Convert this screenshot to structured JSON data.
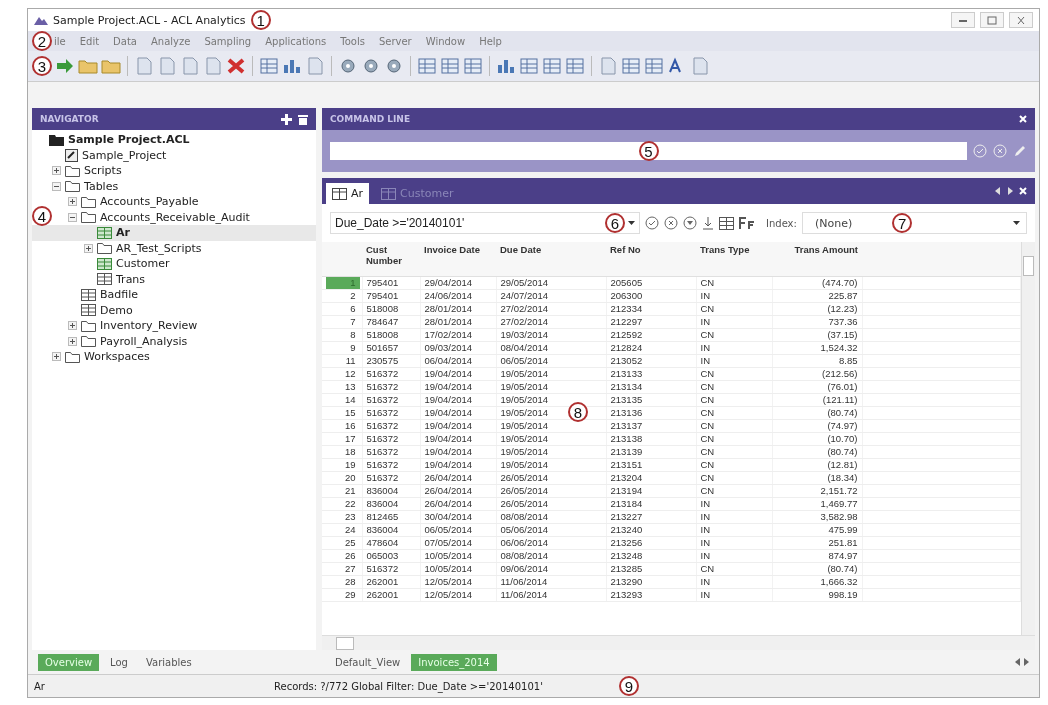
{
  "window": {
    "title": "Sample Project.ACL - ACL Analytics",
    "callout": "1"
  },
  "menu": {
    "callout": "2",
    "items": [
      "ile",
      "Edit",
      "Data",
      "Analyze",
      "Sampling",
      "Applications",
      "Tools",
      "Server",
      "Window",
      "Help"
    ]
  },
  "toolbar": {
    "callout": "3"
  },
  "navigator": {
    "title": "NAVIGATOR",
    "callout": "4",
    "tree": [
      {
        "label": "Sample Project.ACL",
        "kind": "project",
        "selected": false,
        "children": [
          {
            "label": "Sample_Project",
            "kind": "script",
            "selected": false
          },
          {
            "label": "Scripts",
            "kind": "folder",
            "expanded": false,
            "selected": false
          },
          {
            "label": "Tables",
            "kind": "folder",
            "expanded": true,
            "selected": false,
            "children": [
              {
                "label": "Accounts_Payable",
                "kind": "folder",
                "expanded": false,
                "selected": false
              },
              {
                "label": "Accounts_Receivable_Audit",
                "kind": "folder",
                "expanded": true,
                "selected": false,
                "children": [
                  {
                    "label": "Ar",
                    "kind": "table",
                    "open": true,
                    "selected": true
                  },
                  {
                    "label": "AR_Test_Scripts",
                    "kind": "folder",
                    "expanded": false,
                    "selected": false
                  },
                  {
                    "label": "Customer",
                    "kind": "table",
                    "open": true,
                    "selected": false
                  },
                  {
                    "label": "Trans",
                    "kind": "table",
                    "open": false,
                    "selected": false
                  }
                ]
              },
              {
                "label": "Badfile",
                "kind": "table",
                "open": false,
                "selected": false
              },
              {
                "label": "Demo",
                "kind": "table",
                "open": false,
                "selected": false
              },
              {
                "label": "Inventory_Review",
                "kind": "folder",
                "expanded": false,
                "selected": false
              },
              {
                "label": "Payroll_Analysis",
                "kind": "folder",
                "expanded": false,
                "selected": false
              }
            ]
          },
          {
            "label": "Workspaces",
            "kind": "folder",
            "expanded": false,
            "selected": false
          }
        ]
      }
    ]
  },
  "command_line": {
    "title": "COMMAND LINE",
    "callout": "5"
  },
  "view_tabs": [
    {
      "label": "Ar",
      "selected": true
    },
    {
      "label": "Customer",
      "selected": false
    }
  ],
  "filter": {
    "value": "Due_Date >='20140101'",
    "callout": "6",
    "index_label": "Index:",
    "index_value": "(None)",
    "index_callout": "7"
  },
  "table": {
    "callout": "8",
    "columns": [
      {
        "label": "Cust Number"
      },
      {
        "label": "Invoice Date"
      },
      {
        "label": "Due Date"
      },
      {
        "label": "Ref No"
      },
      {
        "label": "Trans Type"
      },
      {
        "label": "Trans Amount"
      }
    ],
    "rows": [
      {
        "n": "1",
        "selected": true,
        "cells": [
          "795401",
          "29/04/2014",
          "29/05/2014",
          "205605",
          "CN",
          "(474.70)"
        ]
      },
      {
        "n": "2",
        "selected": false,
        "cells": [
          "795401",
          "24/06/2014",
          "24/07/2014",
          "206300",
          "IN",
          "225.87"
        ]
      },
      {
        "n": "6",
        "selected": false,
        "cells": [
          "518008",
          "28/01/2014",
          "27/02/2014",
          "212334",
          "CN",
          "(12.23)"
        ]
      },
      {
        "n": "7",
        "selected": false,
        "cells": [
          "784647",
          "28/01/2014",
          "27/02/2014",
          "212297",
          "IN",
          "737.36"
        ]
      },
      {
        "n": "8",
        "selected": false,
        "cells": [
          "518008",
          "17/02/2014",
          "19/03/2014",
          "212592",
          "CN",
          "(37.15)"
        ]
      },
      {
        "n": "9",
        "selected": false,
        "cells": [
          "501657",
          "09/03/2014",
          "08/04/2014",
          "212824",
          "IN",
          "1,524.32"
        ]
      },
      {
        "n": "11",
        "selected": false,
        "cells": [
          "230575",
          "06/04/2014",
          "06/05/2014",
          "213052",
          "IN",
          "8.85"
        ]
      },
      {
        "n": "12",
        "selected": false,
        "cells": [
          "516372",
          "19/04/2014",
          "19/05/2014",
          "213133",
          "CN",
          "(212.56)"
        ]
      },
      {
        "n": "13",
        "selected": false,
        "cells": [
          "516372",
          "19/04/2014",
          "19/05/2014",
          "213134",
          "CN",
          "(76.01)"
        ]
      },
      {
        "n": "14",
        "selected": false,
        "cells": [
          "516372",
          "19/04/2014",
          "19/05/2014",
          "213135",
          "CN",
          "(121.11)"
        ]
      },
      {
        "n": "15",
        "selected": false,
        "cells": [
          "516372",
          "19/04/2014",
          "19/05/2014",
          "213136",
          "CN",
          "(80.74)"
        ]
      },
      {
        "n": "16",
        "selected": false,
        "cells": [
          "516372",
          "19/04/2014",
          "19/05/2014",
          "213137",
          "CN",
          "(74.97)"
        ]
      },
      {
        "n": "17",
        "selected": false,
        "cells": [
          "516372",
          "19/04/2014",
          "19/05/2014",
          "213138",
          "CN",
          "(10.70)"
        ]
      },
      {
        "n": "18",
        "selected": false,
        "cells": [
          "516372",
          "19/04/2014",
          "19/05/2014",
          "213139",
          "CN",
          "(80.74)"
        ]
      },
      {
        "n": "19",
        "selected": false,
        "cells": [
          "516372",
          "19/04/2014",
          "19/05/2014",
          "213151",
          "CN",
          "(12.81)"
        ]
      },
      {
        "n": "20",
        "selected": false,
        "cells": [
          "516372",
          "26/04/2014",
          "26/05/2014",
          "213204",
          "CN",
          "(18.34)"
        ]
      },
      {
        "n": "21",
        "selected": false,
        "cells": [
          "836004",
          "26/04/2014",
          "26/05/2014",
          "213194",
          "CN",
          "2,151.72"
        ]
      },
      {
        "n": "22",
        "selected": false,
        "cells": [
          "836004",
          "26/04/2014",
          "26/05/2014",
          "213184",
          "IN",
          "1,469.77"
        ]
      },
      {
        "n": "23",
        "selected": false,
        "cells": [
          "812465",
          "30/04/2014",
          "08/08/2014",
          "213227",
          "IN",
          "3,582.98"
        ]
      },
      {
        "n": "24",
        "selected": false,
        "cells": [
          "836004",
          "06/05/2014",
          "05/06/2014",
          "213240",
          "IN",
          "475.99"
        ]
      },
      {
        "n": "25",
        "selected": false,
        "cells": [
          "478604",
          "07/05/2014",
          "06/06/2014",
          "213256",
          "IN",
          "251.81"
        ]
      },
      {
        "n": "26",
        "selected": false,
        "cells": [
          "065003",
          "10/05/2014",
          "08/08/2014",
          "213248",
          "IN",
          "874.97"
        ]
      },
      {
        "n": "27",
        "selected": false,
        "cells": [
          "516372",
          "10/05/2014",
          "09/06/2014",
          "213285",
          "CN",
          "(80.74)"
        ]
      },
      {
        "n": "28",
        "selected": false,
        "cells": [
          "262001",
          "12/05/2014",
          "11/06/2014",
          "213290",
          "IN",
          "1,666.32"
        ]
      },
      {
        "n": "29",
        "selected": false,
        "cells": [
          "262001",
          "12/05/2014",
          "11/06/2014",
          "213293",
          "IN",
          "998.19"
        ]
      }
    ]
  },
  "nav_tabs": [
    {
      "label": "Overview",
      "selected": true
    },
    {
      "label": "Log",
      "selected": false
    },
    {
      "label": "Variables",
      "selected": false
    }
  ],
  "views": [
    {
      "label": "Default_View",
      "selected": false
    },
    {
      "label": "Invoices_2014",
      "selected": true
    }
  ],
  "status_bar": {
    "table": "Ar",
    "text": "Records: ?/772  Global Filter: Due_Date >='20140101'",
    "callout": "9"
  }
}
